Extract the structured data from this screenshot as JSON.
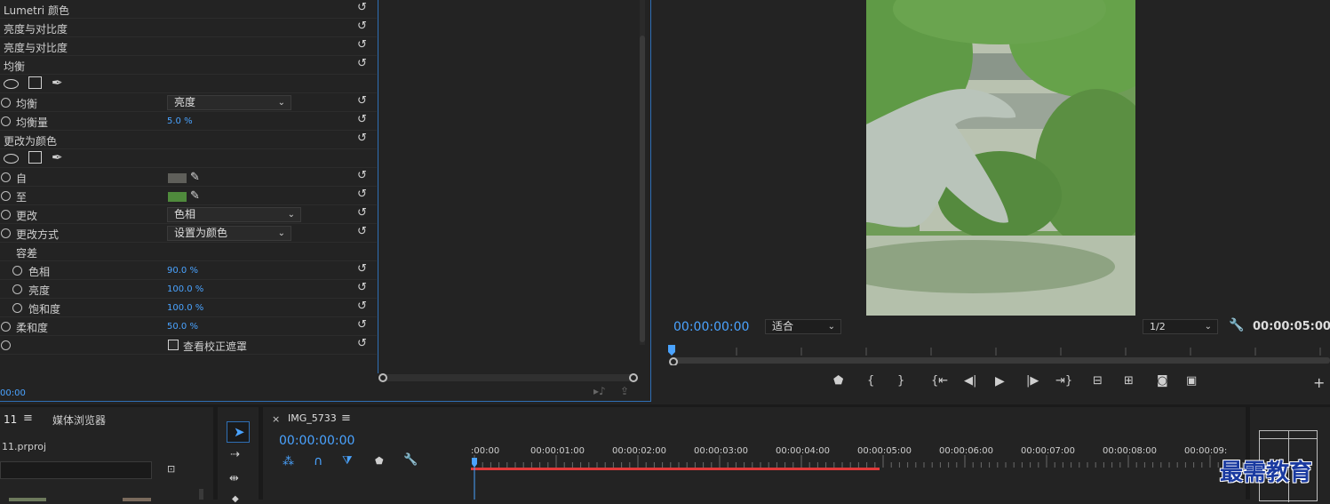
{
  "effect_controls": {
    "rows": [
      {
        "label": "Lumetri 颜色"
      },
      {
        "label": "亮度与对比度"
      },
      {
        "label": "亮度与对比度"
      },
      {
        "label": "均衡"
      },
      {
        "label": ""
      },
      {
        "label": "均衡",
        "dropdown": "亮度"
      },
      {
        "label": "均衡量",
        "value": "5.0 %"
      },
      {
        "label": "更改为颜色"
      },
      {
        "label": ""
      },
      {
        "label": "自"
      },
      {
        "label": "至"
      },
      {
        "label": "更改",
        "dropdown": "色相"
      },
      {
        "label": "更改方式",
        "dropdown": "设置为颜色"
      },
      {
        "label": "容差"
      },
      {
        "label": "色相",
        "value": "90.0 %"
      },
      {
        "label": "亮度",
        "value": "100.0 %"
      },
      {
        "label": "饱和度",
        "value": "100.0 %"
      },
      {
        "label": "柔和度",
        "value": "50.0 %"
      },
      {
        "label": "",
        "checkbox": "查看校正遮罩"
      }
    ],
    "from_color": "#5f5f5a",
    "to_color": "#4f8a3c",
    "timecode": "00:00"
  },
  "program": {
    "timecode": "00:00:00:00",
    "fit": "适合",
    "resolution": "1/2",
    "duration": "00:00:05:00"
  },
  "project": {
    "tab": "11",
    "tab2": "媒体浏览器",
    "file": "11.prproj"
  },
  "timeline": {
    "close": "×",
    "sequence": "IMG_5733",
    "timecode": "00:00:00:00",
    "ticks": [
      ":00:00",
      "00:00:01:00",
      "00:00:02:00",
      "00:00:03:00",
      "00:00:04:00",
      "00:00:05:00",
      "00:00:06:00",
      "00:00:07:00",
      "00:00:08:00",
      "00:00:09:"
    ]
  },
  "watermark": "最需教育",
  "colors": {
    "accent": "#4aa3ff",
    "panel": "#232323",
    "playhead": "#e03a3a"
  }
}
